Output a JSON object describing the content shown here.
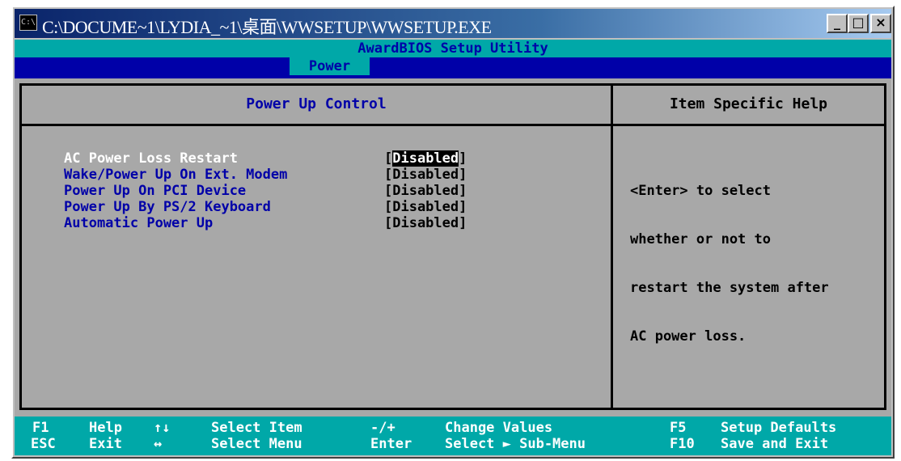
{
  "window": {
    "title": "C:\\DOCUME~1\\LYDIA_~1\\桌面\\WWSETUP\\WWSETUP.EXE",
    "buttons": {
      "minimize": "_",
      "maximize": "□",
      "close": "×"
    }
  },
  "bios": {
    "utility_title": "AwardBIOS Setup Utility",
    "active_menu": "Power",
    "panel_title": "Power Up Control",
    "help_title": "Item Specific Help",
    "items": [
      {
        "label": "AC Power Loss Restart",
        "value_open": "[",
        "value_core": "Disabled",
        "value_close": "]"
      },
      {
        "label": "Wake/Power Up On Ext. Modem",
        "value": "[Disabled]"
      },
      {
        "label": "Power Up On PCI Device",
        "value": "[Disabled]"
      },
      {
        "label": "Power Up By PS/2 Keyboard",
        "value": "[Disabled]"
      },
      {
        "label": "Automatic Power Up",
        "value": "[Disabled]"
      }
    ],
    "help_lines": [
      "<Enter> to select",
      "whether or not to",
      "restart the system after",
      "AC power loss."
    ]
  },
  "footer": {
    "row1": {
      "k1": "F1",
      "d1": "Help",
      "k2": "↑↓",
      "d2": "Select Item",
      "k3": "-/+",
      "d3": "Change Values",
      "k4": "F5",
      "d4": "Setup Defaults"
    },
    "row2": {
      "k1": "ESC",
      "d1": "Exit",
      "k2": "↔",
      "d2": "Select Menu",
      "k3": "Enter",
      "d3": "Select ► Sub-Menu",
      "k4": "F10",
      "d4": "Save and Exit"
    }
  },
  "colors": {
    "bios_blue": "#0000a8",
    "cyan": "#00a8a8",
    "gray": "#a8a8a8",
    "white": "#ffffff",
    "black": "#000000"
  }
}
